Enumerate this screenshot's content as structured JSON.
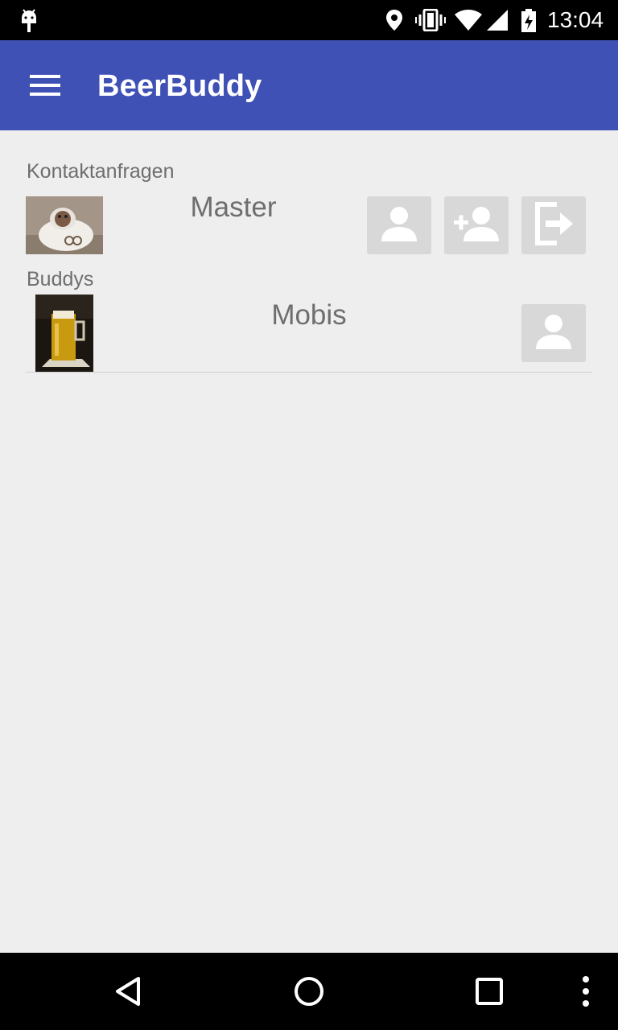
{
  "status_bar": {
    "time": "13:04",
    "icons": [
      "android-debug-icon",
      "location-icon",
      "vibrate-icon",
      "wifi-icon",
      "signal-icon",
      "battery-charging-icon"
    ]
  },
  "app_bar": {
    "title": "BeerBuddy",
    "menu_icon": "hamburger-menu-icon",
    "color": "#3f51b5"
  },
  "sections": {
    "requests": {
      "header": "Kontaktanfragen",
      "items": [
        {
          "name": "Master",
          "avatar": "sheep-photo",
          "actions": [
            "view-profile-icon",
            "accept-contact-icon",
            "decline-contact-icon"
          ]
        }
      ]
    },
    "buddies": {
      "header": "Buddys",
      "items": [
        {
          "name": "Mobis",
          "avatar": "beer-glass-photo",
          "actions": [
            "view-profile-icon"
          ]
        }
      ]
    }
  },
  "nav_bar": {
    "icons": [
      "back-icon",
      "home-icon",
      "recents-icon",
      "overflow-menu-icon"
    ]
  }
}
